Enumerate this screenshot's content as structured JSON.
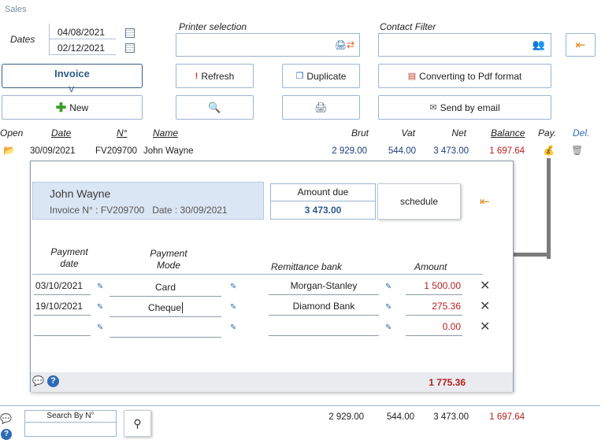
{
  "window": {
    "title": "Sales"
  },
  "filters": {
    "dates_label": "Dates",
    "date_from": "04/08/2021",
    "date_to": "02/12/2021",
    "printer_label": "Printer selection",
    "contact_label": "Contact Filter"
  },
  "toolbar": {
    "invoice_tab": "Invoice",
    "tab_marker": "V",
    "refresh": "Refresh",
    "duplicate": "Duplicate",
    "convert_pdf": "Converting to Pdf format",
    "new": "New",
    "send_email": "Send by email"
  },
  "columns": {
    "open": "Open",
    "date": "Date",
    "number": "N°",
    "name": "Name",
    "brut": "Brut",
    "vat": "Vat",
    "net": "Net",
    "balance": "Balance",
    "pay": "Pay.",
    "del": "Del."
  },
  "rows": [
    {
      "date": "30/09/2021",
      "number": "FV209700",
      "name": "John Wayne",
      "brut": "2 929.00",
      "vat": "544.00",
      "net": "3 473.00",
      "balance": "1 697.64"
    }
  ],
  "payment_dialog": {
    "customer_name": "John Wayne",
    "invoice_line": "Invoice N° : FV209700   Date : 30/09/2021",
    "amount_due_label": "Amount due",
    "amount_due": "3 473.00",
    "schedule": "schedule",
    "headers": {
      "date": "Payment\ndate",
      "mode": "Payment\nMode",
      "bank": "Remittance bank",
      "amount": "Amount"
    },
    "payments": [
      {
        "date": "03/10/2021",
        "mode": "Card",
        "bank": "Morgan-Stanley",
        "amount": "1 500.00"
      },
      {
        "date": "19/10/2021",
        "mode": "Cheque",
        "bank": "Diamond Bank",
        "amount": "275.36"
      },
      {
        "date": "",
        "mode": "",
        "bank": "",
        "amount": "0.00"
      }
    ],
    "total": "1 775.36"
  },
  "footer": {
    "search_label": "Search By  N°",
    "brut": "2 929.00",
    "vat": "544.00",
    "net": "3 473.00",
    "balance": "1 697.64"
  },
  "colors": {
    "accent": "#2d5a8e",
    "border": "#9db4d4",
    "negative": "#b41f1f",
    "panel": "#dbe6f4"
  }
}
